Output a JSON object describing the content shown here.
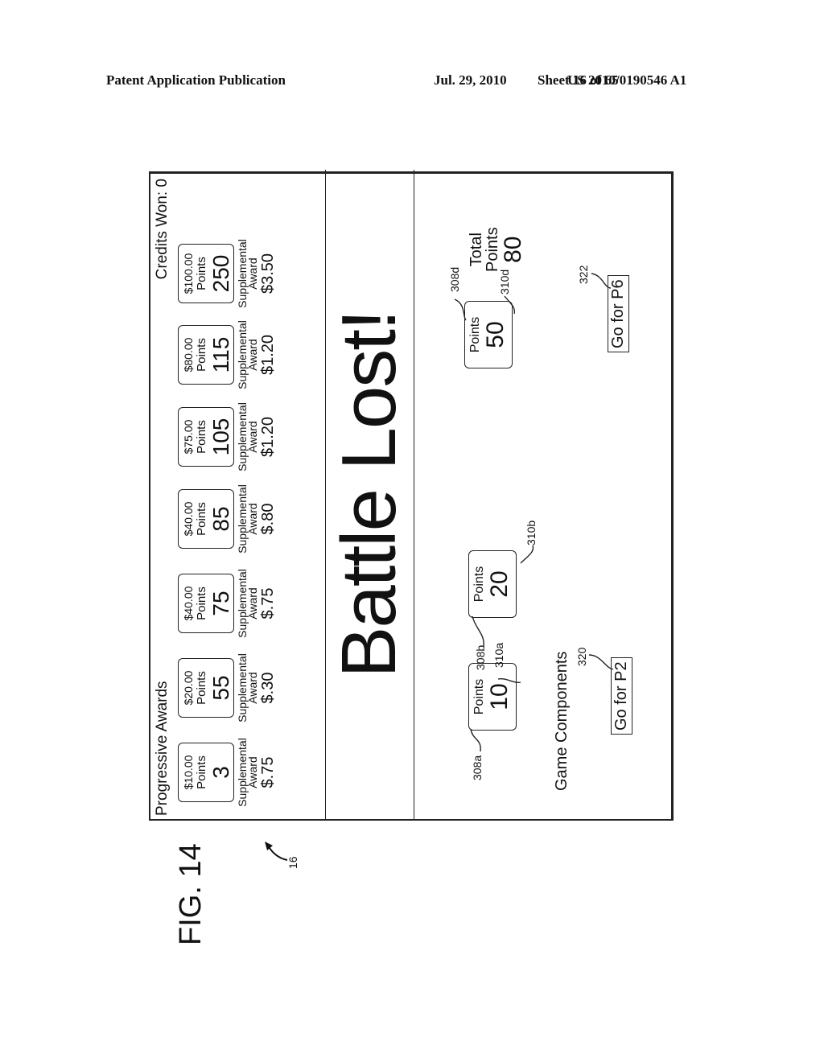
{
  "header": {
    "publication": "Patent Application Publication",
    "date": "Jul. 29, 2010",
    "sheet": "Sheet 16 of 65",
    "number": "US 2010/0190546 A1"
  },
  "figure": {
    "label": "FIG. 14",
    "ref_device": "16"
  },
  "screen": {
    "progressive_title": "Progressive Awards",
    "credits_won": "Credits Won: 0",
    "awards": [
      {
        "amount": "$10.00",
        "points_label": "Points",
        "points": "3",
        "supp_label_1": "Supplemental",
        "supp_label_2": "Award",
        "supp_value": "$.75"
      },
      {
        "amount": "$20.00",
        "points_label": "Points",
        "points": "55",
        "supp_label_1": "Supplemental",
        "supp_label_2": "Award",
        "supp_value": "$.30"
      },
      {
        "amount": "$40.00",
        "points_label": "Points",
        "points": "75",
        "supp_label_1": "Supplemental",
        "supp_label_2": "Award",
        "supp_value": "$.75"
      },
      {
        "amount": "$40.00",
        "points_label": "Points",
        "points": "85",
        "supp_label_1": "Supplemental",
        "supp_label_2": "Award",
        "supp_value": "$.80"
      },
      {
        "amount": "$75.00",
        "points_label": "Points",
        "points": "105",
        "supp_label_1": "Supplemental",
        "supp_label_2": "Award",
        "supp_value": "$1.20"
      },
      {
        "amount": "$80.00",
        "points_label": "Points",
        "points": "115",
        "supp_label_1": "Supplemental",
        "supp_label_2": "Award",
        "supp_value": "$1.20"
      },
      {
        "amount": "$100.00",
        "points_label": "Points",
        "points": "250",
        "supp_label_1": "Supplemental",
        "supp_label_2": "Award",
        "supp_value": "$3.50"
      }
    ],
    "battle_message": "Battle Lost!",
    "components": [
      {
        "label": "Points",
        "value": "10",
        "ref_box": "308a",
        "ref_value": "310a"
      },
      {
        "label": "Points",
        "value": "20",
        "ref_box": "308b",
        "ref_value": "310b"
      },
      {
        "label": "Points",
        "value": "50",
        "ref_box": "308d",
        "ref_value": "310d"
      }
    ],
    "game_components_title": "Game Components",
    "go_buttons": [
      {
        "label": "Go for P2",
        "ref": "320"
      },
      {
        "label": "Go for P6",
        "ref": "322"
      }
    ],
    "total": {
      "label_1": "Total",
      "label_2": "Points",
      "value": "80"
    }
  }
}
